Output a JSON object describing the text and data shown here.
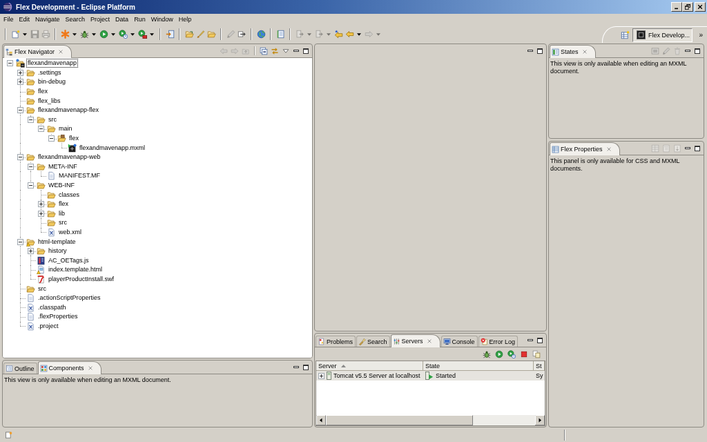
{
  "window": {
    "title": "Flex Development - Eclipse Platform"
  },
  "menu": [
    "File",
    "Edit",
    "Navigate",
    "Search",
    "Project",
    "Data",
    "Run",
    "Window",
    "Help"
  ],
  "toolbar": [
    [
      {
        "kind": "new",
        "dropdown": true,
        "disabled": false
      },
      {
        "kind": "save",
        "disabled": true
      },
      {
        "kind": "print",
        "disabled": true
      }
    ],
    [
      {
        "kind": "build",
        "dropdown": true,
        "disabled": false
      },
      {
        "kind": "debug",
        "dropdown": true,
        "disabled": false
      },
      {
        "kind": "run",
        "dropdown": true,
        "disabled": false
      },
      {
        "kind": "profile",
        "dropdown": true,
        "disabled": false
      },
      {
        "kind": "tools",
        "dropdown": true,
        "disabled": false
      }
    ],
    [
      {
        "kind": "export",
        "disabled": false
      }
    ],
    [
      {
        "kind": "open",
        "disabled": false
      },
      {
        "kind": "brush",
        "disabled": false
      },
      {
        "kind": "folder",
        "disabled": false
      }
    ],
    [
      {
        "kind": "pencil",
        "disabled": true
      },
      {
        "kind": "next",
        "disabled": false
      }
    ],
    [
      {
        "kind": "globe",
        "disabled": false
      }
    ],
    [
      {
        "kind": "document",
        "disabled": false
      }
    ],
    [
      {
        "kind": "nav",
        "dropdown": true,
        "disabled": true
      },
      {
        "kind": "nav",
        "dropdown": true,
        "disabled": true
      },
      {
        "kind": "lastedit",
        "disabled": false
      },
      {
        "kind": "back",
        "dropdown": true,
        "disabled": false
      },
      {
        "kind": "forward",
        "dropdown": true,
        "disabled": true
      }
    ]
  ],
  "perspective_bar": {
    "items": [
      {
        "label": "Flex Develop...",
        "selected": true
      }
    ],
    "more": "»"
  },
  "navigator": {
    "tabs": [
      {
        "label": "Flex Navigator",
        "kind": "navigator",
        "selected": true
      }
    ],
    "tools": [
      [
        {
          "kind": "back",
          "disabled": true
        },
        {
          "kind": "forward",
          "disabled": true
        },
        {
          "kind": "up",
          "disabled": true
        }
      ],
      [
        {
          "kind": "collapse",
          "disabled": false
        },
        {
          "kind": "link",
          "disabled": false
        },
        {
          "kind": "menu",
          "disabled": false
        }
      ]
    ],
    "tree": [
      {
        "label": "flexandmavenapp",
        "kind": "project",
        "selected": true,
        "warning": false,
        "expanded": true,
        "children": [
          {
            "label": ".settings",
            "kind": "folder",
            "selected": false,
            "warning": false,
            "expanded": false
          },
          {
            "label": "bin-debug",
            "kind": "folder",
            "selected": false,
            "warning": false,
            "expanded": false
          },
          {
            "label": "flex",
            "kind": "folder",
            "selected": false,
            "warning": false
          },
          {
            "label": "flex_libs",
            "kind": "folder",
            "selected": false,
            "warning": false
          },
          {
            "label": "flexandmavenapp-flex",
            "kind": "folder",
            "selected": false,
            "warning": false,
            "expanded": true,
            "children": [
              {
                "label": "src",
                "kind": "folder",
                "selected": false,
                "warning": false,
                "expanded": true,
                "children": [
                  {
                    "label": "main",
                    "kind": "folder",
                    "selected": false,
                    "warning": false,
                    "expanded": true,
                    "children": [
                      {
                        "label": "flex",
                        "kind": "package",
                        "selected": false,
                        "warning": false,
                        "expanded": true,
                        "children": [
                          {
                            "label": "flexandmavenapp.mxml",
                            "kind": "mxml",
                            "selected": false,
                            "warning": false
                          }
                        ]
                      }
                    ]
                  }
                ]
              }
            ]
          },
          {
            "label": "flexandmavenapp-web",
            "kind": "folder",
            "selected": false,
            "warning": false,
            "expanded": true,
            "children": [
              {
                "label": "META-INF",
                "kind": "folder",
                "selected": false,
                "warning": false,
                "expanded": true,
                "children": [
                  {
                    "label": "MANIFEST.MF",
                    "kind": "file",
                    "selected": false,
                    "warning": false
                  }
                ]
              },
              {
                "label": "WEB-INF",
                "kind": "folder",
                "selected": false,
                "warning": false,
                "expanded": true,
                "children": [
                  {
                    "label": "classes",
                    "kind": "folder",
                    "selected": false,
                    "warning": false
                  },
                  {
                    "label": "flex",
                    "kind": "folder",
                    "selected": false,
                    "warning": false,
                    "expanded": false
                  },
                  {
                    "label": "lib",
                    "kind": "folder",
                    "selected": false,
                    "warning": false,
                    "expanded": false
                  },
                  {
                    "label": "src",
                    "kind": "folder",
                    "selected": false,
                    "warning": false
                  },
                  {
                    "label": "web.xml",
                    "kind": "xml",
                    "selected": false,
                    "warning": false
                  }
                ]
              }
            ]
          },
          {
            "label": "html-template",
            "kind": "folder",
            "selected": false,
            "warning": true,
            "expanded": true,
            "children": [
              {
                "label": "history",
                "kind": "folder",
                "selected": false,
                "warning": false,
                "expanded": false
              },
              {
                "label": "AC_OETags.js",
                "kind": "js",
                "selected": false,
                "warning": false
              },
              {
                "label": "index.template.html",
                "kind": "html",
                "selected": false,
                "warning": true
              },
              {
                "label": "playerProductInstall.swf",
                "kind": "swf",
                "selected": false,
                "warning": false
              }
            ]
          },
          {
            "label": "src",
            "kind": "folder",
            "selected": false,
            "warning": false
          },
          {
            "label": ".actionScriptProperties",
            "kind": "file",
            "selected": false,
            "warning": false
          },
          {
            "label": ".classpath",
            "kind": "xml",
            "selected": false,
            "warning": false
          },
          {
            "label": ".flexProperties",
            "kind": "file",
            "selected": false,
            "warning": false
          },
          {
            "label": ".project",
            "kind": "xml",
            "selected": false,
            "warning": false
          }
        ]
      }
    ]
  },
  "outline_view": {
    "tabs": [
      {
        "label": "Outline",
        "kind": "outline",
        "selected": false
      },
      {
        "label": "Components",
        "kind": "components",
        "selected": true
      }
    ],
    "message": "This view is only available when editing an MXML document."
  },
  "servers_view": {
    "tabs": [
      {
        "label": "Problems",
        "kind": "problems",
        "selected": false
      },
      {
        "label": "Search",
        "kind": "search",
        "selected": false
      },
      {
        "label": "Servers",
        "kind": "servers",
        "selected": true
      },
      {
        "label": "Console",
        "kind": "console",
        "selected": false
      },
      {
        "label": "Error Log",
        "kind": "errorlog",
        "selected": false
      }
    ],
    "tools": [
      [
        {
          "kind": "debug",
          "disabled": false
        },
        {
          "kind": "run",
          "disabled": false
        },
        {
          "kind": "profile",
          "disabled": false
        },
        {
          "kind": "stop",
          "disabled": false
        },
        {
          "kind": "publish",
          "disabled": false
        }
      ]
    ],
    "table": {
      "columns": [
        {
          "label": "Server",
          "sorted": true
        },
        {
          "label": "State",
          "sorted": false
        },
        {
          "label": "St",
          "sorted": false
        }
      ],
      "rows": [
        {
          "cells": [
            "Tomcat v5.5 Server at localhost",
            "Started",
            "Sy"
          ],
          "selected": true,
          "expanded": false
        }
      ]
    }
  },
  "states_view": {
    "tabs": [
      {
        "label": "States",
        "kind": "states",
        "selected": true
      }
    ],
    "tools": [
      [
        {
          "kind": "newstate",
          "disabled": true
        },
        {
          "kind": "pencil",
          "disabled": true
        },
        {
          "kind": "trash",
          "disabled": true
        }
      ]
    ],
    "message": "This view is only available when editing an MXML document."
  },
  "properties_view": {
    "tabs": [
      {
        "label": "Flex Properties",
        "kind": "properties",
        "selected": true
      }
    ],
    "tools": [
      [
        {
          "kind": "std",
          "disabled": true
        },
        {
          "kind": "cat",
          "disabled": true
        },
        {
          "kind": "sortdown",
          "disabled": true
        }
      ]
    ],
    "message": "This panel is only available for CSS and MXML documents."
  }
}
